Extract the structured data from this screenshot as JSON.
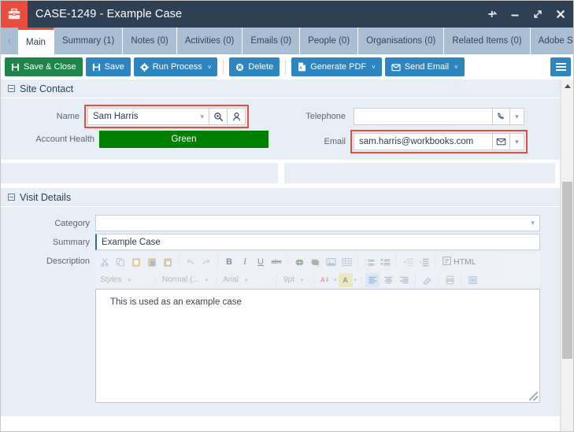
{
  "window": {
    "title": "CASE-1249 - Example Case",
    "app_icon": "briefcase-icon",
    "controls": {
      "pin": "pin-icon",
      "minimize": "minimize-icon",
      "maximize": "expand-icon",
      "close": "close-icon"
    }
  },
  "tabs": {
    "prev_arrow": "‹",
    "next_arrow": "›",
    "items": [
      {
        "label": "Main",
        "active": true
      },
      {
        "label": "Summary (1)",
        "active": false
      },
      {
        "label": "Notes (0)",
        "active": false
      },
      {
        "label": "Activities (0)",
        "active": false
      },
      {
        "label": "Emails (0)",
        "active": false
      },
      {
        "label": "People (0)",
        "active": false
      },
      {
        "label": "Organisations (0)",
        "active": false
      },
      {
        "label": "Related Items (0)",
        "active": false
      },
      {
        "label": "Adobe Sign",
        "active": false
      }
    ]
  },
  "toolbar": {
    "save_close": "Save & Close",
    "save": "Save",
    "run_process": "Run Process",
    "delete": "Delete",
    "generate_pdf": "Generate PDF",
    "send_email": "Send Email",
    "menu": "hamburger-menu-icon",
    "caret": "˅",
    "colors": {
      "primary": "#2e86c1",
      "success": "#1e8449"
    }
  },
  "site_contact": {
    "section_title": "Site Contact",
    "name_label": "Name",
    "name_value": "Sam Harris",
    "name_search_icon": "search-icon",
    "name_person_icon": "person-icon",
    "account_health_label": "Account Health",
    "account_health_value": "Green",
    "account_health_color": "#008000",
    "telephone_label": "Telephone",
    "telephone_value": "",
    "telephone_icon": "phone-icon",
    "email_label": "Email",
    "email_value": "sam.harris@workbooks.com",
    "email_icon": "envelope-icon",
    "highlight_color": "#e74c3c"
  },
  "visit_details": {
    "section_title": "Visit Details",
    "category_label": "Category",
    "category_value": "",
    "summary_label": "Summary",
    "summary_value": "Example Case",
    "description_label": "Description",
    "description_value": "This is used as an example case"
  },
  "editor": {
    "row1_icons": [
      "cut-icon",
      "copy-icon",
      "paste-icon",
      "paste-word-icon",
      "paste-text-icon",
      "undo-icon",
      "redo-icon",
      "bold-icon",
      "italic-icon",
      "underline-icon",
      "strikethrough-icon",
      "link-icon",
      "unlink-icon",
      "image-icon",
      "table-icon",
      "numbered-list-icon",
      "bulleted-list-icon",
      "outdent-icon",
      "indent-icon"
    ],
    "bold": "B",
    "italic": "I",
    "underline": "U",
    "strike": "abc",
    "html_label": "HTML",
    "html_icon": "html-source-icon",
    "styles_label": "Styles",
    "format_label": "Normal (...",
    "font_label": "Arial",
    "size_label": "9pt",
    "text_color_icon": "text-color-icon",
    "bg_color_icon": "background-color-icon",
    "align_left_icon": "align-left-icon",
    "align_center_icon": "align-center-icon",
    "align_right_icon": "align-right-icon",
    "eraser_icon": "remove-format-icon",
    "print_icon": "print-icon",
    "maximize_icon": "maximize-editor-icon",
    "caret": "▾"
  },
  "scrollbar": {
    "up_arrow": "scroll-up-icon"
  }
}
